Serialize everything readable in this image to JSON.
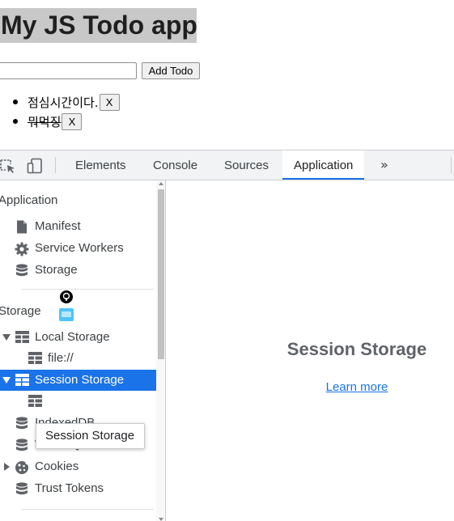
{
  "app": {
    "title": "My JS Todo app",
    "input": {
      "value": "",
      "placeholder": ""
    },
    "add_button": "Add Todo",
    "todos": [
      {
        "text": "점심시간이다.",
        "done": false,
        "delete_label": "X"
      },
      {
        "text": "뭐먹징",
        "done": true,
        "delete_label": "X"
      }
    ]
  },
  "devtools": {
    "toolbar_icons": [
      "inspect-element-icon",
      "device-toolbar-icon"
    ],
    "tabs": [
      {
        "label": "Elements",
        "active": false
      },
      {
        "label": "Console",
        "active": false
      },
      {
        "label": "Sources",
        "active": false
      },
      {
        "label": "Application",
        "active": true
      }
    ],
    "more_tabs_label": "»",
    "sidebar": {
      "application_section": {
        "title": "Application",
        "items": [
          {
            "label": "Manifest",
            "icon": "file-icon"
          },
          {
            "label": "Service Workers",
            "icon": "gear-icon"
          },
          {
            "label": "Storage",
            "icon": "database-icon"
          }
        ]
      },
      "storage_section": {
        "title": "Storage",
        "local_storage": {
          "label": "Local Storage",
          "expanded": true,
          "children": [
            "file://"
          ]
        },
        "session_storage": {
          "label": "Session Storage",
          "expanded": true,
          "selected": true
        },
        "items": [
          {
            "label": "IndexedDB",
            "icon": "database-icon"
          },
          {
            "label": "Web SQL",
            "icon": "database-icon"
          },
          {
            "label": "Cookies",
            "icon": "cookie-icon",
            "collapsed": true
          },
          {
            "label": "Trust Tokens",
            "icon": "database-icon"
          }
        ]
      },
      "tooltip": "Session Storage"
    },
    "main": {
      "title": "Session Storage",
      "link": "Learn more"
    },
    "colors": {
      "accent": "#1a73e8",
      "selected_text": "#ffffff",
      "tab_bar": "#f1f3f4"
    }
  }
}
